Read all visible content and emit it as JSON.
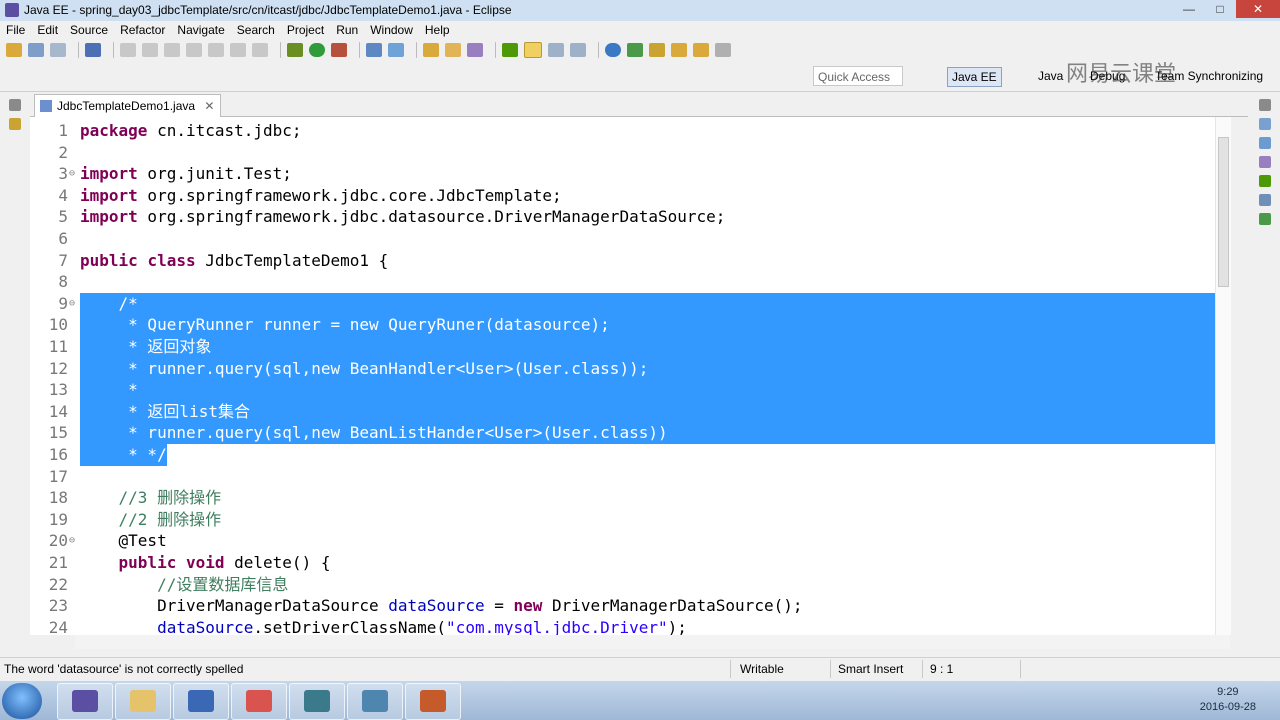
{
  "window": {
    "title": "Java EE - spring_day03_jdbcTemplate/src/cn/itcast/jdbc/JdbcTemplateDemo1.java - Eclipse",
    "buttons": [
      "—",
      "□",
      "✕"
    ]
  },
  "menu": [
    "File",
    "Edit",
    "Source",
    "Refactor",
    "Navigate",
    "Search",
    "Project",
    "Run",
    "Window",
    "Help"
  ],
  "perspective_bar": {
    "quick_access_placeholder": "Quick Access",
    "perspectives": [
      "Java EE",
      "Java",
      "Debug",
      "Team Synchronizing"
    ],
    "active": "Java EE"
  },
  "watermark": "网易云课堂",
  "editor": {
    "tab_label": "JdbcTemplateDemo1.java",
    "tab_close": "✕",
    "lines": [
      {
        "n": "1",
        "segs": [
          {
            "t": "package",
            "c": "k"
          },
          {
            "t": " cn.itcast.jdbc;"
          }
        ]
      },
      {
        "n": "2",
        "segs": []
      },
      {
        "n": "3",
        "segs": [
          {
            "t": "import",
            "c": "k"
          },
          {
            "t": " org.junit.Test;"
          }
        ],
        "fold": true
      },
      {
        "n": "4",
        "segs": [
          {
            "t": "import",
            "c": "k"
          },
          {
            "t": " org.springframework.jdbc.core.JdbcTemplate;"
          }
        ]
      },
      {
        "n": "5",
        "segs": [
          {
            "t": "import",
            "c": "k"
          },
          {
            "t": " org.springframework.jdbc.datasource.DriverManagerDataSource;"
          }
        ]
      },
      {
        "n": "6",
        "segs": []
      },
      {
        "n": "7",
        "segs": [
          {
            "t": "public",
            "c": "k"
          },
          {
            "t": " "
          },
          {
            "t": "class",
            "c": "k"
          },
          {
            "t": " JdbcTemplateDemo1 {"
          }
        ]
      },
      {
        "n": "8",
        "segs": []
      },
      {
        "n": "9",
        "segs": [
          {
            "t": "    /*"
          }
        ],
        "sel": true,
        "fold": true
      },
      {
        "n": "10",
        "segs": [
          {
            "t": "     * QueryRunner runner = new QueryRuner(datasource);"
          }
        ],
        "sel": true
      },
      {
        "n": "11",
        "segs": [
          {
            "t": "     * 返回对象"
          }
        ],
        "sel": true
      },
      {
        "n": "12",
        "segs": [
          {
            "t": "     * runner.query(sql,new BeanHandler<User>(User.class));"
          }
        ],
        "sel": true
      },
      {
        "n": "13",
        "segs": [
          {
            "t": "     *"
          }
        ],
        "sel": true
      },
      {
        "n": "14",
        "segs": [
          {
            "t": "     * 返回list集合"
          }
        ],
        "sel": true
      },
      {
        "n": "15",
        "segs": [
          {
            "t": "     * runner.query(sql,new BeanListHander<User>(User.class))"
          }
        ],
        "sel": true
      },
      {
        "n": "16",
        "segs": [
          {
            "t": "     * */"
          }
        ],
        "selpartial": true
      },
      {
        "n": "17",
        "segs": []
      },
      {
        "n": "18",
        "segs": [
          {
            "t": "    "
          },
          {
            "t": "//3 删除操作",
            "c": "c"
          }
        ]
      },
      {
        "n": "19",
        "segs": [
          {
            "t": "    "
          },
          {
            "t": "//2 删除操作",
            "c": "c"
          }
        ]
      },
      {
        "n": "20",
        "segs": [
          {
            "t": "    @Test"
          }
        ],
        "fold": true
      },
      {
        "n": "21",
        "segs": [
          {
            "t": "    "
          },
          {
            "t": "public",
            "c": "k"
          },
          {
            "t": " "
          },
          {
            "t": "void",
            "c": "k"
          },
          {
            "t": " delete() {"
          }
        ]
      },
      {
        "n": "22",
        "segs": [
          {
            "t": "        "
          },
          {
            "t": "//设置数据库信息",
            "c": "c"
          }
        ]
      },
      {
        "n": "23",
        "segs": [
          {
            "t": "        DriverManagerDataSource "
          },
          {
            "t": "dataSource",
            "c": "f"
          },
          {
            "t": " = "
          },
          {
            "t": "new",
            "c": "k"
          },
          {
            "t": " DriverManagerDataSource();"
          }
        ]
      },
      {
        "n": "24",
        "segs": [
          {
            "t": "        "
          },
          {
            "t": "dataSource",
            "c": "f"
          },
          {
            "t": ".setDriverClassName("
          },
          {
            "t": "\"com.mysql.jdbc.Driver\"",
            "c": "s"
          },
          {
            "t": ");"
          }
        ]
      }
    ]
  },
  "status": {
    "message": "The word 'datasource' is not correctly spelled",
    "writable": "Writable",
    "insert_mode": "Smart Insert",
    "position": "9 : 1"
  },
  "taskbar": {
    "time": "9:29",
    "date": "2016-09-28"
  },
  "colors": {
    "selection": "#3399ff",
    "keyword": "#7f0055",
    "comment": "#3f7f5f",
    "string": "#2a00ff",
    "field": "#0000c0"
  }
}
